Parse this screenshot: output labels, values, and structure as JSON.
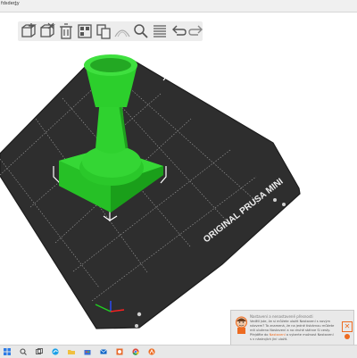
{
  "window": {
    "tab_label": "fdsderty",
    "tab_chevron": "⌄"
  },
  "toolbar": {
    "buttons": [
      {
        "icon": "add-object-icon"
      },
      {
        "icon": "delete-icon"
      },
      {
        "icon": "delete-all-icon"
      },
      {
        "icon": "arrange-icon"
      },
      {
        "icon": "copy-icon"
      },
      {
        "icon": "paste-icon"
      },
      {
        "icon": "search-icon"
      },
      {
        "icon": "layers-icon"
      },
      {
        "icon": "undo-icon"
      },
      {
        "icon": "redo-icon"
      }
    ]
  },
  "bed": {
    "label": "ORIGINAL PRUSA MINI",
    "color": "#2e2e2e",
    "grid_color": "#9a9a9a"
  },
  "model": {
    "color": "#2fd12f",
    "shade": "#1c9f1c"
  },
  "notification": {
    "title": "Nastavení a nenastavené přesnosti",
    "body_lines": [
      "Vedělí jste, že si můžete uložit Nastavení s novým",
      "názvem? Ta znamená, že na jedné tiskárnou můžete",
      "mít uloženo Nastavení a na druhé stáhne Si cesty.",
      "Přejděte do",
      "a vyberte možnost Nastavení",
      "s v nástrojích jíní uložit."
    ],
    "link_text": "Nastavení",
    "close_symbol": "✕",
    "accent": "#ed6b21"
  },
  "taskbar": {
    "icons": [
      "windows-icon",
      "search-icon",
      "task-view-icon",
      "edge-icon",
      "folder-icon",
      "store-icon",
      "mail-icon",
      "photos-icon",
      "chrome-icon",
      "prusaslicer-icon"
    ]
  }
}
